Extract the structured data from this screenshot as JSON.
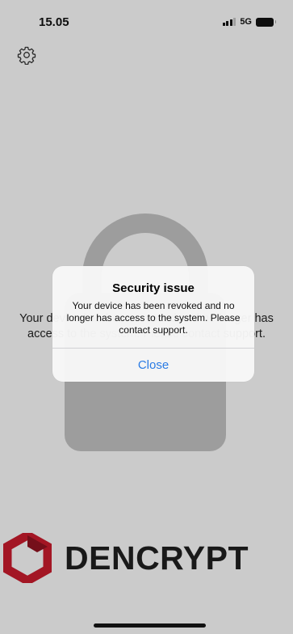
{
  "status_bar": {
    "time": "15.05",
    "network": "5G"
  },
  "icons": {
    "settings": "gear-icon",
    "lock": "lock-icon",
    "signal": "signal-icon",
    "battery": "battery-icon",
    "logo": "dencrypt-hexagon-icon"
  },
  "background": {
    "message": "Your device has been revoked and no longer has access to the system. Please contact support."
  },
  "alert": {
    "title": "Security issue",
    "message": "Your device has been revoked and no longer has access to the system. Please contact support.",
    "close_label": "Close"
  },
  "logo": {
    "text": "DENCRYPT"
  },
  "colors": {
    "brand_red": "#c31b2c",
    "link_blue": "#2a7be4"
  }
}
